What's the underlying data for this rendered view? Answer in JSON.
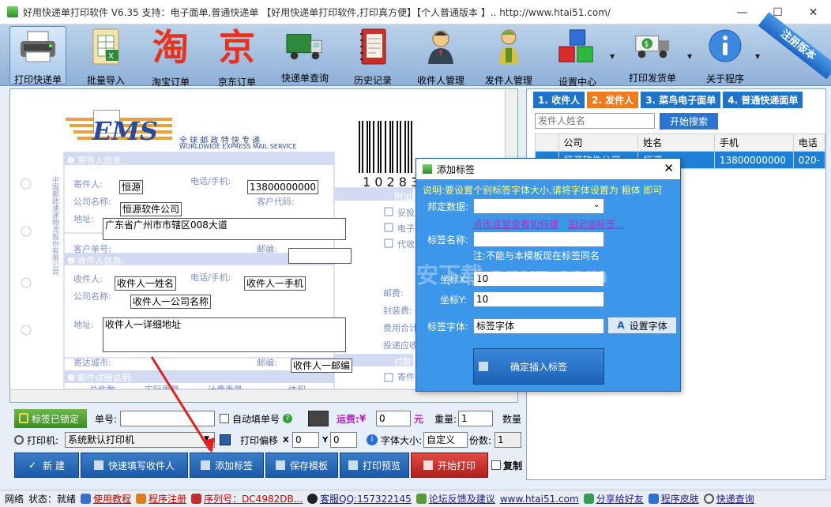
{
  "window": {
    "title": "好用快递单打印软件 V6.35  支持：电子面单,普通快递单 【好用快递单打印软件,打印真方便】【个人普通版本 】..  http://www.htai51.com/"
  },
  "toolbar": {
    "items": [
      {
        "label": "打印快递单",
        "icon": "printer-icon"
      },
      {
        "label": "批量导入",
        "icon": "excel-import-icon"
      },
      {
        "label": "淘宝订单",
        "icon": "taobao-icon",
        "glyph": "淘"
      },
      {
        "label": "京东订单",
        "icon": "jd-icon",
        "glyph": "京"
      },
      {
        "label": "快递单查询",
        "icon": "truck-icon"
      },
      {
        "label": "历史记录",
        "icon": "notebook-icon"
      },
      {
        "label": "收件人管理",
        "icon": "recipient-user-icon"
      },
      {
        "label": "发件人管理",
        "icon": "sender-user-icon"
      },
      {
        "label": "设置中心",
        "icon": "cubes-icon"
      },
      {
        "label": "打印发货单",
        "icon": "money-truck-icon"
      },
      {
        "label": "关于程序",
        "icon": "info-icon"
      }
    ],
    "ribbon": "注册版本"
  },
  "canvas": {
    "fields": {
      "sender_name": "恒源",
      "sender_phone": "13800000000",
      "sender_company": "恒源软件公司",
      "sender_address": "广东省广州市市辖区008大道",
      "recv_name": "收件人一姓名",
      "recv_phone": "收件人一手机",
      "recv_company": "收件人一公司名称",
      "recv_address": "收件人一详细地址",
      "recv_zip": "收件人一邮编"
    },
    "form": {
      "ems_logo": "EMS",
      "ems_cn": "全 球 邮 政 特 快 专 递",
      "ems_en": "WORLDWIDE EXPRESS MAIL SERVICE",
      "barcode_digits": "1 0 2 8 3",
      "section_sender": "❶ 寄件人信息:",
      "sender_label": "寄件人:",
      "sender_phone_label": "电话/手机:",
      "company_label": "公司名称:",
      "customer_code_label": "客户代码:",
      "address_label": "地址:",
      "customer_sig_label": "客户单号:",
      "zip_label": "邮编:",
      "section_recv": "❷ 收件人信息:",
      "recv_label": "收件人:",
      "recv_phone_label": "电话/手机:",
      "recv_company_label": "公司名称:",
      "recv_address_label": "地址:",
      "dest_city_label": "寄达城市:",
      "recv_zip_label": "邮编:",
      "section_detail": "❸ 邮件详细说明:",
      "detail_cols": [
        "总件数",
        "实际重量",
        "计费重量",
        "体积"
      ],
      "right_col": [
        "附加服",
        "妥投",
        "电子",
        "代收",
        "邮费:",
        "封装费:",
        "费用合计",
        "投递应收",
        "付款方",
        "寄件"
      ],
      "side_text": "中国邮政速递物流股份有限公司"
    }
  },
  "controls": {
    "locked_label": "标签已锁定",
    "order_no_label": "单号:",
    "order_no_value": "",
    "auto_fill_label": "自动填单号",
    "freight_label": "运费:",
    "freight_currency": "¥",
    "freight_value": "0",
    "freight_unit": "元",
    "weight_label": "重量:",
    "weight_value": "1",
    "qty_label": "数量",
    "printer_label": "打印机:",
    "printer_value": "系统默认打印机",
    "offset_label": "打印偏移",
    "offset_x_label": "X",
    "offset_x": "0",
    "offset_y_label": "Y",
    "offset_y": "0",
    "font_size_label": "字体大小:",
    "font_size_value": "自定义",
    "copies_label": "份数:",
    "copies_value": "1",
    "buttons": [
      "新  建",
      "快速填写收件人",
      "添加标签",
      "保存模板",
      "打印预览",
      "开始打印"
    ],
    "copy_label": "复制"
  },
  "right": {
    "tabs": [
      "1. 收件人",
      "2. 发件人",
      "3. 菜鸟电子面单",
      "4. 普通快递面单"
    ],
    "search_placeholder": "发件人姓名",
    "search_button": "开始搜索",
    "columns": [
      "公司",
      "姓名",
      "手机",
      "电话"
    ],
    "rows": [
      [
        "恒源软件公司",
        "恒源",
        "13800000000",
        "020-"
      ]
    ]
  },
  "dialog": {
    "title": "添加标签",
    "note": "说明:要设置个别标签字体大小,请将字体设置为 粗体 即可",
    "bind_label": "邦定数据:",
    "bind_value": "",
    "help_link": "点击这里查看如何建",
    "fixed_link": "固定值标签...",
    "name_label": "标签名称:",
    "name_value": "",
    "name_hint": "注:不能与本模板现在标签同名",
    "x_label": "坐标X:",
    "x_value": "10",
    "y_label": "坐标Y:",
    "y_value": "10",
    "font_label": "标签字体:",
    "font_value": "标签字体",
    "font_button": "设置字体",
    "confirm_button": "确定插入标签",
    "watermark": "安下载 anxz.com"
  },
  "status": {
    "network": "网络",
    "state": "状态：就绪",
    "tutorial": "使用教程",
    "register": "程序注册",
    "serial": "序列号：DC4982DB...",
    "qq": "客服QQ:157322145",
    "forum": "论坛反馈及建议",
    "site": "www.htai51.com",
    "share": "分享给好友",
    "skin": "程序皮肤",
    "track": "快递查询"
  },
  "colors": {
    "tab_blue": "#1f73c9",
    "tab_orange": "#f07a1e",
    "dialog_bg": "#3c96ea",
    "note_yellow": "#ffff66",
    "link_purple": "#b030c0",
    "print_red": "#d0312d"
  }
}
